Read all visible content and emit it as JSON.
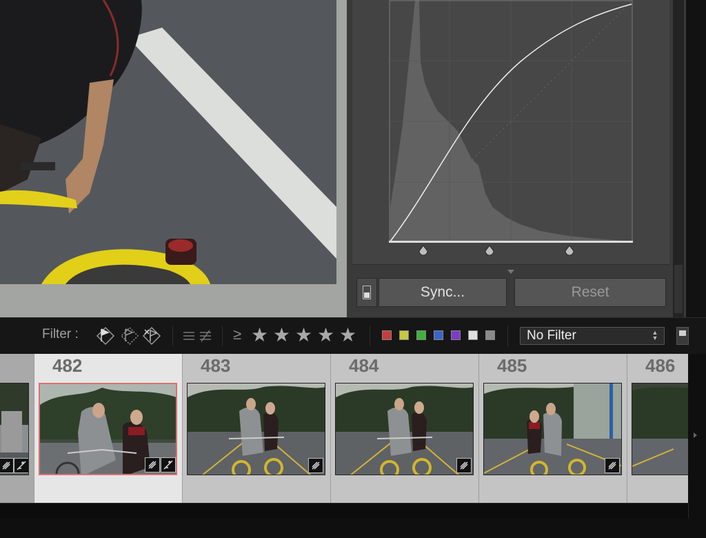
{
  "panel": {
    "sync_label": "Sync...",
    "reset_label": "Reset"
  },
  "filter_bar": {
    "label": "Filter :",
    "rating_operator": "≥",
    "stars": [
      "★",
      "★",
      "★",
      "★",
      "★"
    ],
    "color_labels": [
      "#c83c3c",
      "#c8c83c",
      "#3cb43c",
      "#3c64c8",
      "#7a3cc8",
      "#e0e0e0",
      "#8a8a8a"
    ],
    "preset": "No Filter"
  },
  "filmstrip": {
    "cells": [
      {
        "number": ""
      },
      {
        "number": "482"
      },
      {
        "number": "483"
      },
      {
        "number": "484"
      },
      {
        "number": "485"
      },
      {
        "number": "486"
      }
    ]
  },
  "colors": {
    "accent_selected": "#d77272",
    "panel_bg": "#3a3a3a",
    "filmstrip_bg": "#c0c0c0"
  }
}
